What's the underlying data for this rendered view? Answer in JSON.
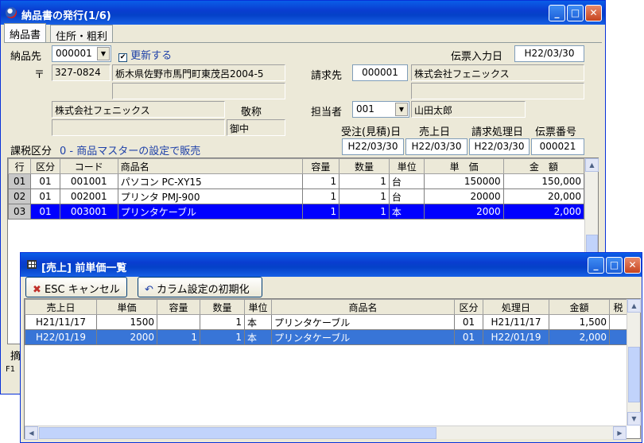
{
  "main_window": {
    "title": "納品書の発行(1/6)",
    "tabs": [
      "納品書",
      "住所・粗利"
    ],
    "delivery_to_label": "納品先",
    "delivery_to_code": "000001",
    "update_checkbox_label": "更新する",
    "postal_symbol": "〒",
    "postal_code": "327-0824",
    "address1": "栃木県佐野市馬門町東茂呂2004-5",
    "address2": "",
    "company_name": "株式会社フェニックス",
    "honorific_label": "敬称",
    "honorific_value": "御中",
    "slip_entry_date_label": "伝票入力日",
    "slip_entry_date": "H22/03/30",
    "billing_label": "請求先",
    "billing_code": "000001",
    "billing_name": "株式会社フェニックス",
    "rep_label": "担当者",
    "rep_code": "001",
    "rep_name": "山田太郎",
    "order_date_label": "受注(見積)日",
    "sales_date_label": "売上日",
    "billing_date_label": "請求処理日",
    "slip_no_label": "伝票番号",
    "order_date": "H22/03/30",
    "sales_date": "H22/03/30",
    "billing_date": "H22/03/30",
    "slip_no": "000021",
    "tax_label": "課税区分",
    "tax_value": "0 - 商品マスターの設定で販売",
    "bottom_tab_fragment": "摘",
    "fkey": "F1",
    "grid_headers": [
      "行",
      "区分",
      "コード",
      "商品名",
      "容量",
      "数量",
      "単位",
      "単　価",
      "金　額"
    ],
    "grid_rows": [
      {
        "row": "01",
        "kubun": "01",
        "code": "001001",
        "name": "パソコン PC-XY15",
        "cap": "1",
        "qty": "1",
        "unit": "台",
        "price": "150000",
        "amount": "150,000"
      },
      {
        "row": "02",
        "kubun": "01",
        "code": "002001",
        "name": "プリンタ PMJ-900",
        "cap": "1",
        "qty": "1",
        "unit": "台",
        "price": "20000",
        "amount": "20,000"
      },
      {
        "row": "03",
        "kubun": "01",
        "code": "003001",
        "name": "プリンタケーブル",
        "cap": "1",
        "qty": "1",
        "unit": "本",
        "price": "2000",
        "amount": "2,000"
      }
    ]
  },
  "popup": {
    "title": "[売上] 前単価一覧",
    "cancel_button": "ESC キャンセル",
    "reset_button": "カラム設定の初期化",
    "headers": [
      "売上日",
      "単価",
      "容量",
      "数量",
      "単位",
      "商品名",
      "区分",
      "処理日",
      "金額",
      "税"
    ],
    "rows": [
      {
        "date": "H21/11/17",
        "price": "1500",
        "cap": "",
        "qty": "1",
        "unit": "本",
        "name": "プリンタケーブル",
        "kubun": "01",
        "proc": "H21/11/17",
        "amount": "1,500"
      },
      {
        "date": "H22/01/19",
        "price": "2000",
        "cap": "1",
        "qty": "1",
        "unit": "本",
        "name": "プリンタケーブル",
        "kubun": "01",
        "proc": "H22/01/19",
        "amount": "2,000"
      }
    ]
  }
}
